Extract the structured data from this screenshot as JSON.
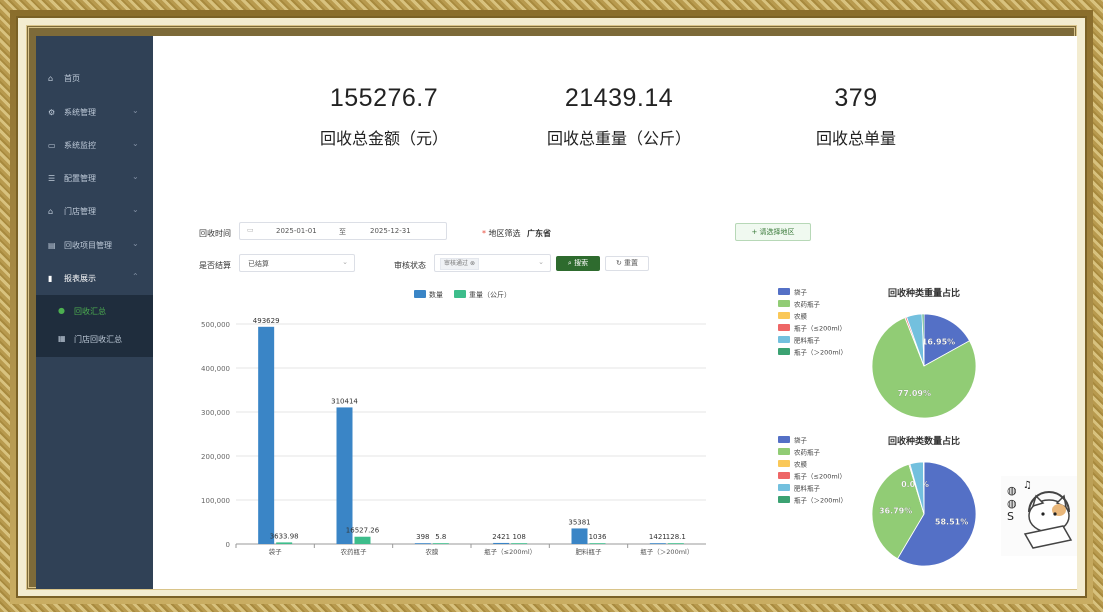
{
  "sidebar": {
    "items": [
      {
        "label": "首页",
        "icon": "home-icon",
        "has_chevron": false
      },
      {
        "label": "系统管理",
        "icon": "system-icon",
        "has_chevron": true
      },
      {
        "label": "系统监控",
        "icon": "monitor-icon",
        "has_chevron": true
      },
      {
        "label": "配置管理",
        "icon": "config-icon",
        "has_chevron": true
      },
      {
        "label": "门店管理",
        "icon": "store-icon",
        "has_chevron": true
      },
      {
        "label": "回收项目管理",
        "icon": "project-icon",
        "has_chevron": true
      },
      {
        "label": "报表展示",
        "icon": "chart-icon",
        "has_chevron": true
      }
    ],
    "sub_items": [
      {
        "label": "回收汇总",
        "active": true
      },
      {
        "label": "门店回收汇总",
        "active": false
      }
    ]
  },
  "stats": [
    {
      "value": "155276.7",
      "label": "回收总金额（元）"
    },
    {
      "value": "21439.14",
      "label": "回收总重量（公斤）"
    },
    {
      "value": "379",
      "label": "回收总单量"
    }
  ],
  "filters": {
    "time_label": "回收时间",
    "start_date": "2025-01-01",
    "range_sep": "至",
    "end_date": "2025-12-31",
    "region_label": "地区筛选",
    "region_value": "广东省",
    "select_region_button": "+ 请选择地区",
    "settled_label": "是否结算",
    "settled_value": "已结算",
    "audit_label": "审核状态",
    "audit_tag": "审核通过",
    "search_button": "搜索",
    "reset_button": "重置"
  },
  "colors": {
    "count": "#3a85c6",
    "weight": "#3dbd8b",
    "sidebar": "#304156",
    "active": "#4caf50"
  },
  "chart_data": [
    {
      "type": "bar",
      "legend": [
        "数量",
        "重量（公斤）"
      ],
      "categories": [
        "袋子",
        "农药瓶子",
        "农膜",
        "瓶子（≤200ml）",
        "肥料瓶子",
        "瓶子（＞200ml）"
      ],
      "series": [
        {
          "name": "数量",
          "values": [
            493629,
            310414,
            398,
            2421,
            35381,
            1421
          ],
          "labels": [
            "493629",
            "310414",
            "398",
            "2421",
            "35381",
            "1421"
          ]
        },
        {
          "name": "重量（公斤）",
          "values": [
            3633.98,
            16527.26,
            5.8,
            108,
            1036,
            128.1
          ],
          "labels": [
            "3633.98",
            "16527.26",
            "5.8",
            "108",
            "1036",
            "128.1"
          ]
        }
      ],
      "yticks": [
        "0",
        "100,000",
        "200,000",
        "300,000",
        "400,000",
        "500,000"
      ],
      "ylim": [
        0,
        500000
      ]
    },
    {
      "type": "pie",
      "title": "回收种类重量占比",
      "legend": [
        {
          "name": "袋子",
          "color": "#5470c6"
        },
        {
          "name": "农药瓶子",
          "color": "#91cc75"
        },
        {
          "name": "农膜",
          "color": "#fac858"
        },
        {
          "name": "瓶子（≤200ml）",
          "color": "#ee6666"
        },
        {
          "name": "肥料瓶子",
          "color": "#73c0de"
        },
        {
          "name": "瓶子（＞200ml）",
          "color": "#3ba272"
        }
      ],
      "values": [
        16.95,
        77.09,
        0.03,
        0.5,
        4.83,
        0.6
      ],
      "labels": [
        "16.95%",
        "77.09%"
      ]
    },
    {
      "type": "pie",
      "title": "回收种类数量占比",
      "legend": [
        {
          "name": "袋子",
          "color": "#5470c6"
        },
        {
          "name": "农药瓶子",
          "color": "#91cc75"
        },
        {
          "name": "农膜",
          "color": "#fac858"
        },
        {
          "name": "瓶子（≤200ml）",
          "color": "#ee6666"
        },
        {
          "name": "肥料瓶子",
          "color": "#73c0de"
        },
        {
          "name": "瓶子（＞200ml）",
          "color": "#3ba272"
        }
      ],
      "values": [
        58.51,
        36.79,
        0.05,
        0.29,
        4.19,
        0.17
      ],
      "labels": [
        "58.51%",
        "36.79%",
        "0.05%"
      ]
    }
  ]
}
